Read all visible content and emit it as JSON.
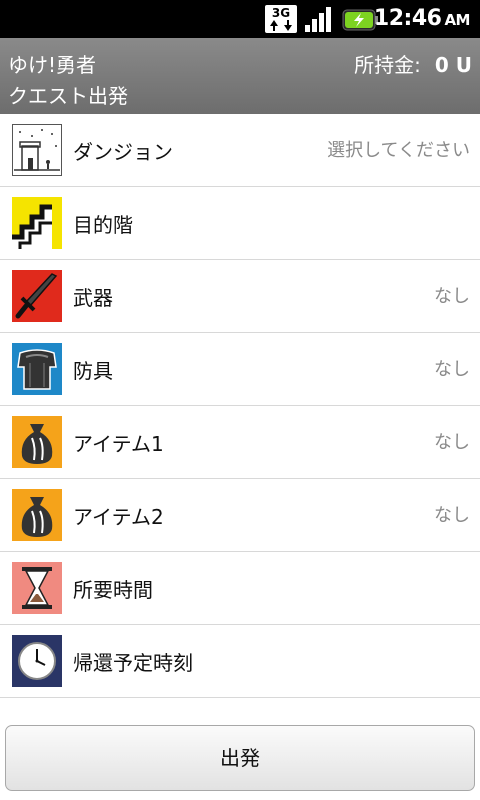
{
  "status_bar": {
    "network": "3G",
    "time": "12:46",
    "ampm": "AM"
  },
  "header": {
    "app_name": "ゆけ!勇者",
    "screen_title": "クエスト出発",
    "money_label": "所持金:",
    "money_value": "0 U"
  },
  "rows": [
    {
      "label": "ダンジョン",
      "value": "選択してください",
      "icon": "dungeon-icon"
    },
    {
      "label": "目的階",
      "value": "",
      "icon": "stairs-icon"
    },
    {
      "label": "武器",
      "value": "なし",
      "icon": "sword-icon"
    },
    {
      "label": "防具",
      "value": "なし",
      "icon": "armor-icon"
    },
    {
      "label": "アイテム1",
      "value": "なし",
      "icon": "item-bag-icon"
    },
    {
      "label": "アイテム2",
      "value": "なし",
      "icon": "item-bag-icon"
    },
    {
      "label": "所要時間",
      "value": "",
      "icon": "hourglass-icon"
    },
    {
      "label": "帰還予定時刻",
      "value": "",
      "icon": "clock-icon"
    }
  ],
  "footer": {
    "depart_label": "出発"
  }
}
